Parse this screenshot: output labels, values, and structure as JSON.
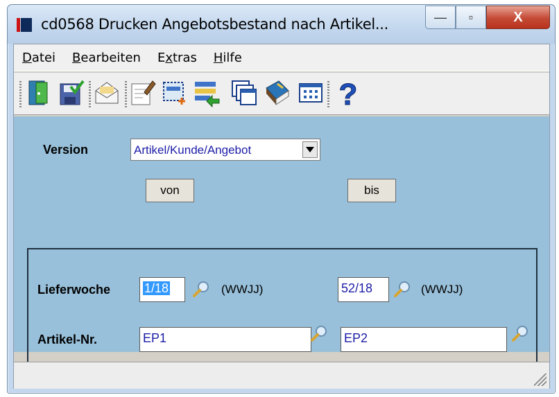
{
  "window": {
    "title": "cd0568 Drucken Angebotsbestand nach Artikel...",
    "controls": {
      "minimize": "—",
      "maximize": "▫",
      "close": "X"
    }
  },
  "menu": [
    {
      "label": "Datei",
      "mnemonic": "D"
    },
    {
      "label": "Bearbeiten",
      "mnemonic": "B"
    },
    {
      "label": "Extras",
      "mnemonic": "x"
    },
    {
      "label": "Hilfe",
      "mnemonic": "H"
    }
  ],
  "toolbar": {
    "icons": [
      "exit-door-icon",
      "save-check-icon",
      "mail-envelope-icon",
      "edit-document-icon",
      "select-area-icon",
      "list-arrow-icon",
      "windows-stack-icon",
      "book-icon",
      "grid-window-icon",
      "help-question-icon"
    ],
    "help_glyph": "?"
  },
  "form": {
    "version_label": "Version",
    "version_value": "Artikel/Kunde/Angebot",
    "von_label": "von",
    "bis_label": "bis",
    "lieferwoche_label": "Lieferwoche",
    "lieferwoche_von": "1/18",
    "lieferwoche_bis": "52/18",
    "wwjj_hint": "(WWJJ)",
    "artikel_label": "Artikel-Nr.",
    "artikel_von": "EP1",
    "artikel_bis": "EP2"
  },
  "colors": {
    "form_background": "#98c0da",
    "input_text": "#1c1ca8",
    "selection": "#3399ff"
  }
}
